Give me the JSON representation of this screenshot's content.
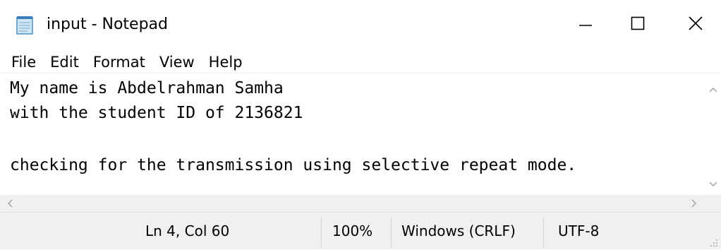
{
  "window": {
    "title": "input - Notepad",
    "app_icon": "notepad-icon",
    "controls": {
      "minimize_icon": "minimize-icon",
      "maximize_icon": "maximize-icon",
      "close_icon": "close-icon"
    }
  },
  "menu": {
    "items": [
      {
        "label": "File"
      },
      {
        "label": "Edit"
      },
      {
        "label": "Format"
      },
      {
        "label": "View"
      },
      {
        "label": "Help"
      }
    ]
  },
  "editor": {
    "lines": [
      "My name is Abdelrahman Samha",
      "with the student ID of 2136821",
      "",
      "checking for the transmission using selective repeat mode."
    ]
  },
  "statusbar": {
    "position": "Ln 4, Col 60",
    "zoom": "100%",
    "line_ending": "Windows (CRLF)",
    "encoding": "UTF-8"
  },
  "colors": {
    "chrome_background": "#f0f0f0",
    "editor_background": "#ffffff",
    "text": "#000000",
    "scroll_arrow": "#a0a0a0"
  }
}
